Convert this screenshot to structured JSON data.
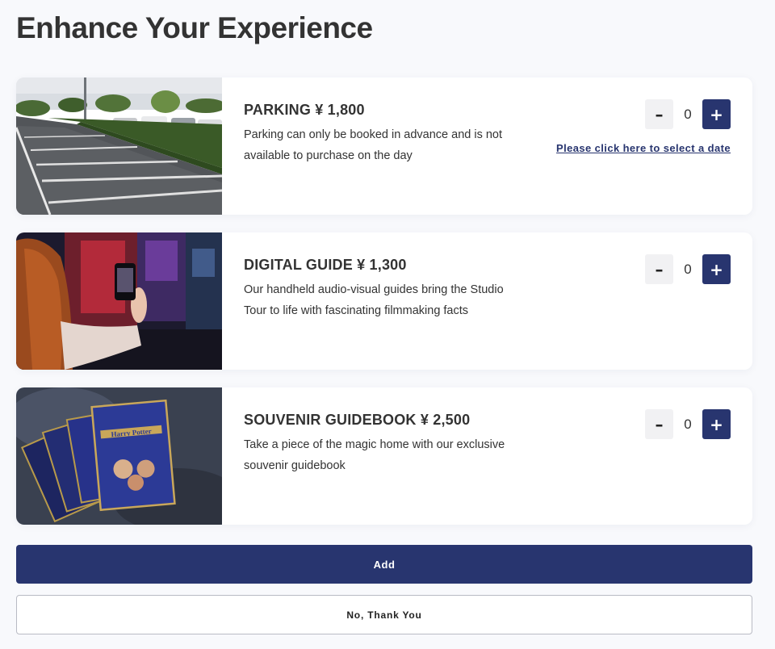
{
  "page": {
    "title": "Enhance Your Experience"
  },
  "items": [
    {
      "title": "PARKING ¥ 1,800",
      "description": "Parking can only be booked in advance and is not available to purchase on the day",
      "quantity": "0",
      "minus_label": "–",
      "plus_label": "+",
      "date_link": "Please click here to select a date"
    },
    {
      "title": "DIGITAL GUIDE ¥ 1,300",
      "description": "Our handheld audio-visual guides bring the Studio Tour to life with fascinating filmmaking facts",
      "quantity": "0",
      "minus_label": "–",
      "plus_label": "+"
    },
    {
      "title": "SOUVENIR GUIDEBOOK ¥ 2,500",
      "description": "Take a piece of the magic home with our exclusive souvenir guidebook",
      "quantity": "0",
      "minus_label": "–",
      "plus_label": "+",
      "book_cover_text": "Harry Potter"
    }
  ],
  "actions": {
    "add_label": "Add",
    "decline_label": "No, Thank You"
  },
  "theme": {
    "accent": "#28356f",
    "background": "#f8f9fc"
  }
}
